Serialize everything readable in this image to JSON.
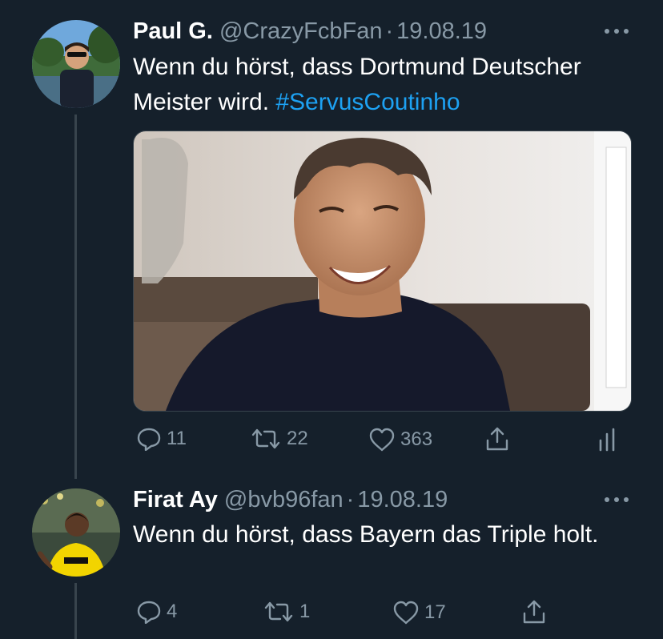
{
  "tweets": [
    {
      "name": "Paul G.",
      "handle": "@CrazyFcbFan",
      "dot": "·",
      "date": "19.08.19",
      "text": "Wenn du hörst, dass Dortmund Deutscher Meister wird. ",
      "hashtag": "#ServusCoutinho",
      "replies": "11",
      "retweets": "22",
      "likes": "363"
    },
    {
      "name": "Firat Ay",
      "handle": "@bvb96fan",
      "dot": "·",
      "date": "19.08.19",
      "text": "Wenn du hörst, dass Bayern das Triple holt.",
      "replies": "4",
      "retweets": "1",
      "likes": "17"
    }
  ],
  "colors": {
    "background": "#15202b",
    "secondary_text": "#8899a6",
    "link": "#1da1f2",
    "thread_line": "#38444d"
  }
}
